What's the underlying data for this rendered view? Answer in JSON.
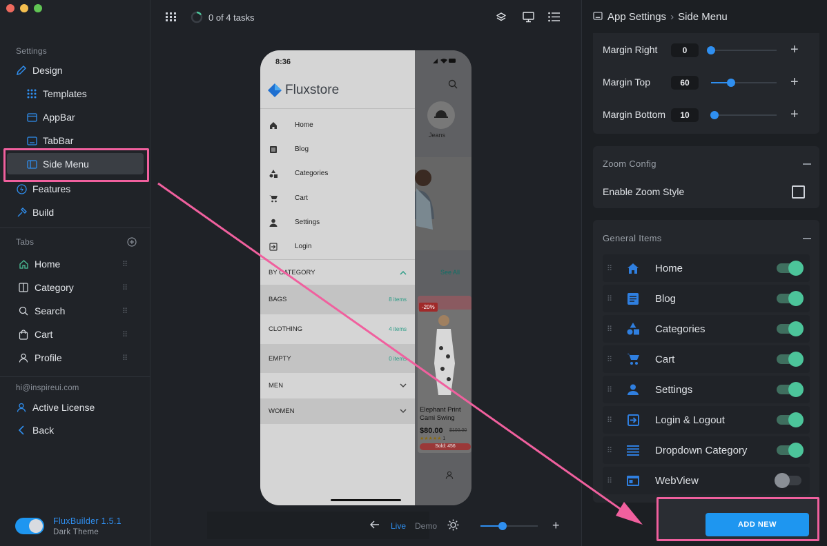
{
  "sidebar": {
    "settings_label": "Settings",
    "design": "Design",
    "templates": "Templates",
    "appbar": "AppBar",
    "tabbar": "TabBar",
    "side_menu": "Side Menu",
    "features": "Features",
    "build": "Build",
    "tabs_label": "Tabs",
    "tabs": [
      "Home",
      "Category",
      "Search",
      "Cart",
      "Profile"
    ],
    "email": "hi@inspireui.com",
    "active_license": "Active License",
    "back": "Back",
    "app_name": "FluxBuilder 1.5.1",
    "theme": "Dark Theme"
  },
  "topbar": {
    "tasks": "0 of 4 tasks"
  },
  "phone": {
    "time": "8:36",
    "brand": "Fluxstore",
    "menu": [
      "Home",
      "Blog",
      "Categories",
      "Cart",
      "Settings",
      "Login"
    ],
    "by_category": "BY CATEGORY",
    "categories": [
      {
        "name": "BAGS",
        "count": "8 items"
      },
      {
        "name": "CLOTHING",
        "count": "4 items"
      },
      {
        "name": "EMPTY",
        "count": "0 items"
      },
      {
        "name": "MEN",
        "count": ""
      },
      {
        "name": "WOMEN",
        "count": ""
      }
    ],
    "bg_jeans": "Jeans",
    "bg_see_all": "See All",
    "bg_discount": "-20%",
    "bg_product_name": "Elephant Print Cami Swing",
    "bg_price": "$80.00",
    "bg_old_price": "$100.00",
    "bg_rating": "1",
    "bg_sold": "Sold: 456"
  },
  "bottombar": {
    "live": "Live",
    "demo": "Demo",
    "zoom_level": 0.38
  },
  "right": {
    "breadcrumb_root": "App Settings",
    "breadcrumb_current": "Side Menu",
    "margin_right_label": "Margin Right",
    "margin_right": "0",
    "margin_right_level": 0.0,
    "margin_top_label": "Margin Top",
    "margin_top": "60",
    "margin_top_level": 0.3,
    "margin_bottom_label": "Margin Bottom",
    "margin_bottom": "10",
    "margin_bottom_level": 0.05,
    "zoom_config": "Zoom Config",
    "enable_zoom": "Enable Zoom Style",
    "general_items": "General Items",
    "items": [
      {
        "label": "Home",
        "on": true
      },
      {
        "label": "Blog",
        "on": true
      },
      {
        "label": "Categories",
        "on": true
      },
      {
        "label": "Cart",
        "on": true
      },
      {
        "label": "Settings",
        "on": true
      },
      {
        "label": "Login & Logout",
        "on": true
      },
      {
        "label": "Dropdown Category",
        "on": true
      },
      {
        "label": "WebView",
        "on": false
      }
    ],
    "add_new": "ADD NEW"
  },
  "colors": {
    "accent": "#2f8ff0",
    "toggle_on": "#4cc49a",
    "highlight": "#f0609e"
  }
}
